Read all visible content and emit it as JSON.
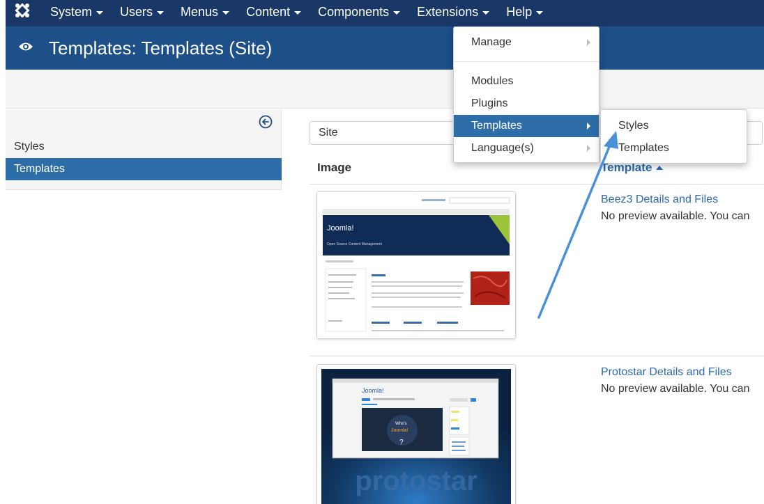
{
  "topnav": {
    "logo_icon": "joomla-logo-icon",
    "items": [
      {
        "label": "System"
      },
      {
        "label": "Users"
      },
      {
        "label": "Menus"
      },
      {
        "label": "Content"
      },
      {
        "label": "Components"
      },
      {
        "label": "Extensions"
      },
      {
        "label": "Help"
      }
    ]
  },
  "header": {
    "icon": "eye-icon",
    "title": "Templates: Templates (Site)"
  },
  "sidebar": {
    "items": [
      {
        "label": "Styles"
      },
      {
        "label": "Templates"
      }
    ],
    "toggle_icon": "arrow-left-circle-icon"
  },
  "filter": {
    "value": "Site"
  },
  "table": {
    "col_image": "Image",
    "col_template": "Template",
    "rows": [
      {
        "link": "Beez3 Details and Files",
        "desc": "No preview available. You can"
      },
      {
        "link": "Protostar Details and Files",
        "desc": "No preview available. You can"
      }
    ]
  },
  "extensions_menu": {
    "items": [
      {
        "label": "Manage"
      },
      {
        "label": "Modules"
      },
      {
        "label": "Plugins"
      },
      {
        "label": "Templates"
      },
      {
        "label": "Language(s)"
      }
    ]
  },
  "templates_submenu": {
    "items": [
      {
        "label": "Styles"
      },
      {
        "label": "Templates"
      }
    ]
  },
  "thumbs": {
    "beez_brand": "Joomla!",
    "beez_tagline": "Open Source Content Management",
    "protostar_brand": "Joomla!",
    "protostar_word": "protostar"
  },
  "colors": {
    "topnav": "#1a3867",
    "header": "#1d4f88",
    "active": "#2e6ea8",
    "link": "#2a6ab0",
    "annotation_arrow": "#4a90d9"
  }
}
